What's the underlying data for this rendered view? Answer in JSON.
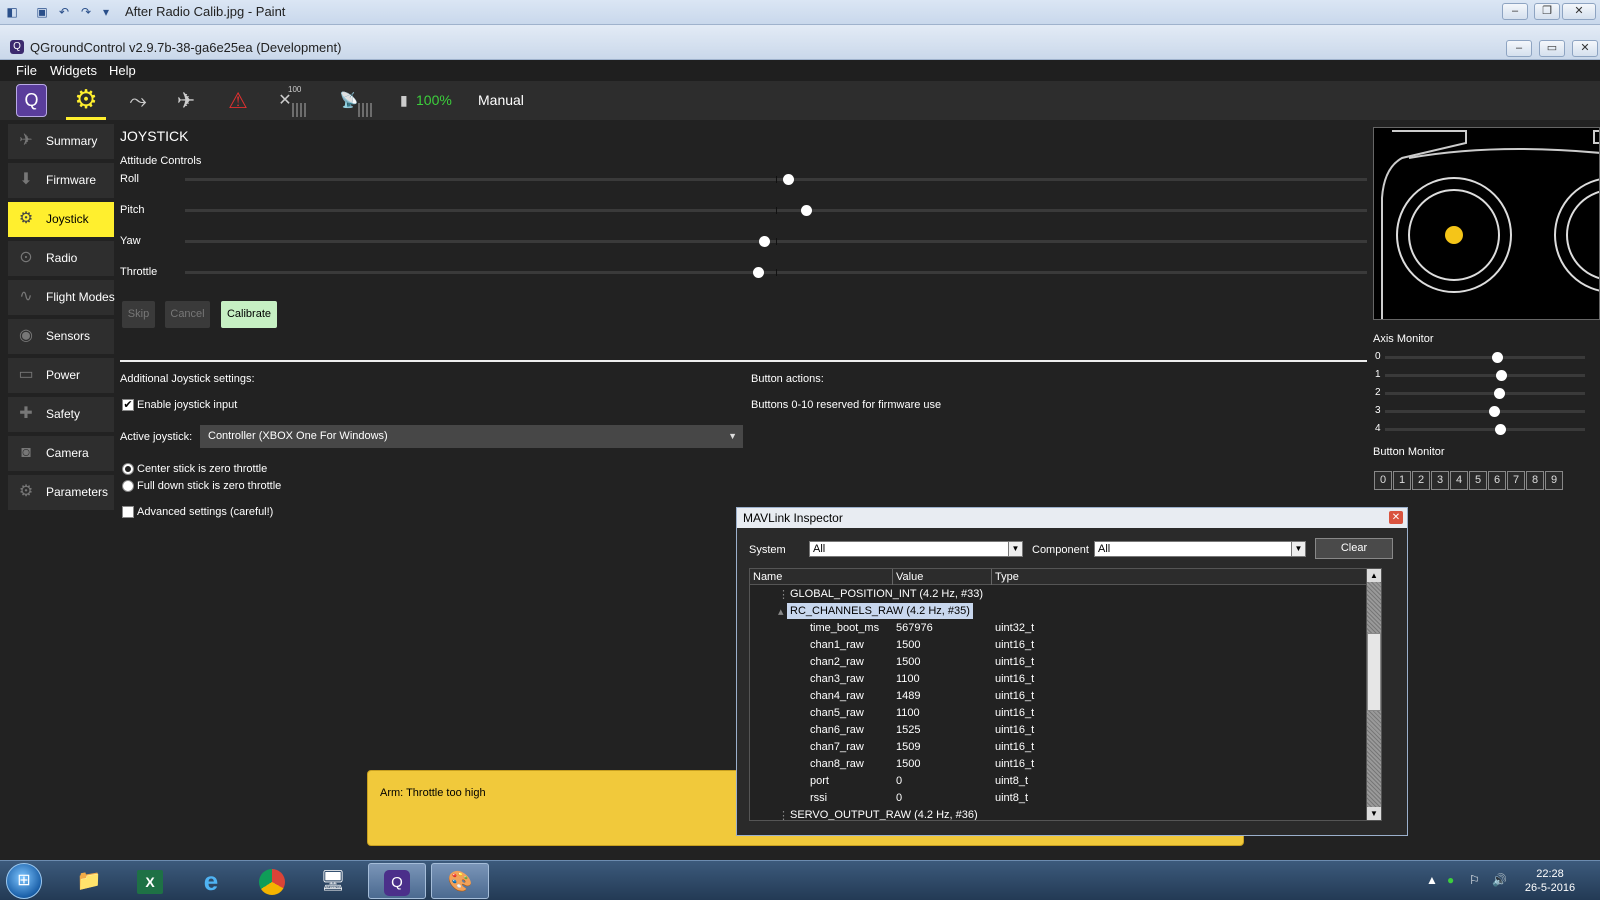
{
  "paint_window": {
    "title": "After Radio Calib.jpg - Paint"
  },
  "qgc_window": {
    "title": "QGroundControl v2.9.7b-38-ga6e25ea (Development)"
  },
  "menu": [
    "File",
    "Widgets",
    "Help"
  ],
  "toolbar": {
    "signal_count": "100",
    "battery_percent": "100%",
    "flight_mode": "Manual",
    "colors": {
      "active": "#ffef2e",
      "warning": "#e23030",
      "battery": "#3ccf3c"
    }
  },
  "sidebar": {
    "items": [
      {
        "label": "Summary",
        "icon": "plane-icon"
      },
      {
        "label": "Firmware",
        "icon": "firmware-icon"
      },
      {
        "label": "Joystick",
        "icon": "gears-icon",
        "active": true
      },
      {
        "label": "Radio",
        "icon": "radio-icon"
      },
      {
        "label": "Flight Modes",
        "icon": "wave-icon"
      },
      {
        "label": "Sensors",
        "icon": "sensor-icon"
      },
      {
        "label": "Power",
        "icon": "battery-icon"
      },
      {
        "label": "Safety",
        "icon": "medkit-icon"
      },
      {
        "label": "Camera",
        "icon": "camera-icon"
      },
      {
        "label": "Parameters",
        "icon": "gears-icon"
      }
    ]
  },
  "joystick": {
    "title": "JOYSTICK",
    "attitude_label": "Attitude Controls",
    "axes": [
      {
        "name": "Roll",
        "value": 0.02
      },
      {
        "name": "Pitch",
        "value": 0.05
      },
      {
        "name": "Yaw",
        "value": -0.02
      },
      {
        "name": "Throttle",
        "value": -0.03
      }
    ],
    "buttons": {
      "skip": "Skip",
      "cancel": "Cancel",
      "calibrate": "Calibrate"
    },
    "additional_label": "Additional Joystick settings:",
    "enable_label": "Enable joystick input",
    "active_label": "Active joystick:",
    "active_value": "Controller (XBOX One For Windows)",
    "center_label": "Center stick is zero throttle",
    "fulldown_label": "Full down stick is zero throttle",
    "advanced_label": "Advanced settings (careful!)",
    "button_actions_label": "Button actions:",
    "reserved_label": "Buttons 0-10 reserved for firmware use"
  },
  "axis_monitor": {
    "title": "Axis Monitor",
    "axes": [
      {
        "label": "0",
        "value": 0.12
      },
      {
        "label": "1",
        "value": 0.16
      },
      {
        "label": "2",
        "value": 0.14
      },
      {
        "label": "3",
        "value": 0.09
      },
      {
        "label": "4",
        "value": 0.15
      }
    ]
  },
  "button_monitor": {
    "title": "Button Monitor",
    "buttons": [
      "0",
      "1",
      "2",
      "3",
      "4",
      "5",
      "6",
      "7",
      "8",
      "9"
    ]
  },
  "warning": {
    "text": "Arm: Throttle too high",
    "color": "#f1c93b"
  },
  "inspector": {
    "title": "MAVLink Inspector",
    "system_label": "System",
    "system_value": "All",
    "component_label": "Component",
    "component_value": "All",
    "clear_label": "Clear",
    "columns": [
      "Name",
      "Value",
      "Type"
    ],
    "rows": [
      {
        "name": "GLOBAL_POSITION_INT (4.2 Hz, #33)",
        "value": "",
        "type": "",
        "level": 0
      },
      {
        "name": "RC_CHANNELS_RAW (4.2 Hz, #35)",
        "value": "",
        "type": "",
        "level": 0,
        "selected": true
      },
      {
        "name": "time_boot_ms",
        "value": "567976",
        "type": "uint32_t",
        "level": 1
      },
      {
        "name": "chan1_raw",
        "value": "1500",
        "type": "uint16_t",
        "level": 1
      },
      {
        "name": "chan2_raw",
        "value": "1500",
        "type": "uint16_t",
        "level": 1
      },
      {
        "name": "chan3_raw",
        "value": "1100",
        "type": "uint16_t",
        "level": 1
      },
      {
        "name": "chan4_raw",
        "value": "1489",
        "type": "uint16_t",
        "level": 1
      },
      {
        "name": "chan5_raw",
        "value": "1100",
        "type": "uint16_t",
        "level": 1
      },
      {
        "name": "chan6_raw",
        "value": "1525",
        "type": "uint16_t",
        "level": 1
      },
      {
        "name": "chan7_raw",
        "value": "1509",
        "type": "uint16_t",
        "level": 1
      },
      {
        "name": "chan8_raw",
        "value": "1500",
        "type": "uint16_t",
        "level": 1
      },
      {
        "name": "port",
        "value": "0",
        "type": "uint8_t",
        "level": 1
      },
      {
        "name": "rssi",
        "value": "0",
        "type": "uint8_t",
        "level": 1
      },
      {
        "name": "SERVO_OUTPUT_RAW (4.2 Hz, #36)",
        "value": "",
        "type": "",
        "level": 0
      }
    ]
  },
  "taskbar": {
    "time": "22:28",
    "date": "26-5-2016",
    "apps": [
      "explorer-icon",
      "excel-icon",
      "ie-icon",
      "chrome-icon",
      "remote-desktop-icon",
      "qgc-icon",
      "paint-icon"
    ]
  }
}
